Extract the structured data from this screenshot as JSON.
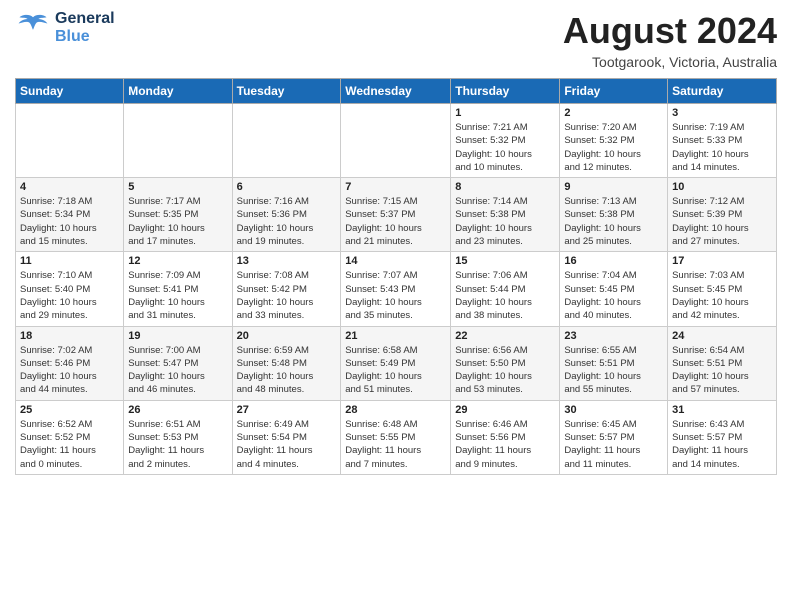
{
  "header": {
    "logo_general": "General",
    "logo_blue": "Blue",
    "month_year": "August 2024",
    "location": "Tootgarook, Victoria, Australia"
  },
  "days_of_week": [
    "Sunday",
    "Monday",
    "Tuesday",
    "Wednesday",
    "Thursday",
    "Friday",
    "Saturday"
  ],
  "weeks": [
    [
      {
        "day": "",
        "info": ""
      },
      {
        "day": "",
        "info": ""
      },
      {
        "day": "",
        "info": ""
      },
      {
        "day": "",
        "info": ""
      },
      {
        "day": "1",
        "info": "Sunrise: 7:21 AM\nSunset: 5:32 PM\nDaylight: 10 hours\nand 10 minutes."
      },
      {
        "day": "2",
        "info": "Sunrise: 7:20 AM\nSunset: 5:32 PM\nDaylight: 10 hours\nand 12 minutes."
      },
      {
        "day": "3",
        "info": "Sunrise: 7:19 AM\nSunset: 5:33 PM\nDaylight: 10 hours\nand 14 minutes."
      }
    ],
    [
      {
        "day": "4",
        "info": "Sunrise: 7:18 AM\nSunset: 5:34 PM\nDaylight: 10 hours\nand 15 minutes."
      },
      {
        "day": "5",
        "info": "Sunrise: 7:17 AM\nSunset: 5:35 PM\nDaylight: 10 hours\nand 17 minutes."
      },
      {
        "day": "6",
        "info": "Sunrise: 7:16 AM\nSunset: 5:36 PM\nDaylight: 10 hours\nand 19 minutes."
      },
      {
        "day": "7",
        "info": "Sunrise: 7:15 AM\nSunset: 5:37 PM\nDaylight: 10 hours\nand 21 minutes."
      },
      {
        "day": "8",
        "info": "Sunrise: 7:14 AM\nSunset: 5:38 PM\nDaylight: 10 hours\nand 23 minutes."
      },
      {
        "day": "9",
        "info": "Sunrise: 7:13 AM\nSunset: 5:38 PM\nDaylight: 10 hours\nand 25 minutes."
      },
      {
        "day": "10",
        "info": "Sunrise: 7:12 AM\nSunset: 5:39 PM\nDaylight: 10 hours\nand 27 minutes."
      }
    ],
    [
      {
        "day": "11",
        "info": "Sunrise: 7:10 AM\nSunset: 5:40 PM\nDaylight: 10 hours\nand 29 minutes."
      },
      {
        "day": "12",
        "info": "Sunrise: 7:09 AM\nSunset: 5:41 PM\nDaylight: 10 hours\nand 31 minutes."
      },
      {
        "day": "13",
        "info": "Sunrise: 7:08 AM\nSunset: 5:42 PM\nDaylight: 10 hours\nand 33 minutes."
      },
      {
        "day": "14",
        "info": "Sunrise: 7:07 AM\nSunset: 5:43 PM\nDaylight: 10 hours\nand 35 minutes."
      },
      {
        "day": "15",
        "info": "Sunrise: 7:06 AM\nSunset: 5:44 PM\nDaylight: 10 hours\nand 38 minutes."
      },
      {
        "day": "16",
        "info": "Sunrise: 7:04 AM\nSunset: 5:45 PM\nDaylight: 10 hours\nand 40 minutes."
      },
      {
        "day": "17",
        "info": "Sunrise: 7:03 AM\nSunset: 5:45 PM\nDaylight: 10 hours\nand 42 minutes."
      }
    ],
    [
      {
        "day": "18",
        "info": "Sunrise: 7:02 AM\nSunset: 5:46 PM\nDaylight: 10 hours\nand 44 minutes."
      },
      {
        "day": "19",
        "info": "Sunrise: 7:00 AM\nSunset: 5:47 PM\nDaylight: 10 hours\nand 46 minutes."
      },
      {
        "day": "20",
        "info": "Sunrise: 6:59 AM\nSunset: 5:48 PM\nDaylight: 10 hours\nand 48 minutes."
      },
      {
        "day": "21",
        "info": "Sunrise: 6:58 AM\nSunset: 5:49 PM\nDaylight: 10 hours\nand 51 minutes."
      },
      {
        "day": "22",
        "info": "Sunrise: 6:56 AM\nSunset: 5:50 PM\nDaylight: 10 hours\nand 53 minutes."
      },
      {
        "day": "23",
        "info": "Sunrise: 6:55 AM\nSunset: 5:51 PM\nDaylight: 10 hours\nand 55 minutes."
      },
      {
        "day": "24",
        "info": "Sunrise: 6:54 AM\nSunset: 5:51 PM\nDaylight: 10 hours\nand 57 minutes."
      }
    ],
    [
      {
        "day": "25",
        "info": "Sunrise: 6:52 AM\nSunset: 5:52 PM\nDaylight: 11 hours\nand 0 minutes."
      },
      {
        "day": "26",
        "info": "Sunrise: 6:51 AM\nSunset: 5:53 PM\nDaylight: 11 hours\nand 2 minutes."
      },
      {
        "day": "27",
        "info": "Sunrise: 6:49 AM\nSunset: 5:54 PM\nDaylight: 11 hours\nand 4 minutes."
      },
      {
        "day": "28",
        "info": "Sunrise: 6:48 AM\nSunset: 5:55 PM\nDaylight: 11 hours\nand 7 minutes."
      },
      {
        "day": "29",
        "info": "Sunrise: 6:46 AM\nSunset: 5:56 PM\nDaylight: 11 hours\nand 9 minutes."
      },
      {
        "day": "30",
        "info": "Sunrise: 6:45 AM\nSunset: 5:57 PM\nDaylight: 11 hours\nand 11 minutes."
      },
      {
        "day": "31",
        "info": "Sunrise: 6:43 AM\nSunset: 5:57 PM\nDaylight: 11 hours\nand 14 minutes."
      }
    ]
  ]
}
